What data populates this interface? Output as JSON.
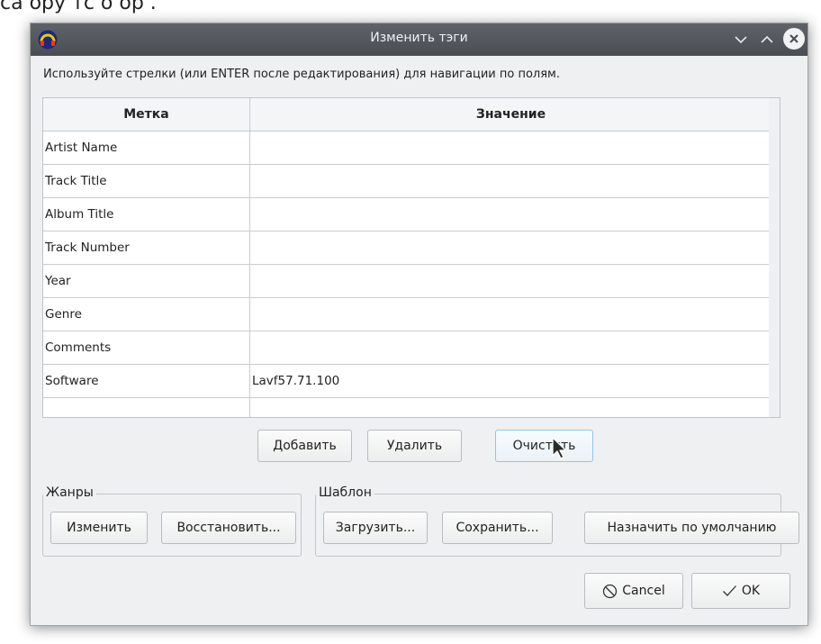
{
  "partial_top_text": "са ору тс о ор .",
  "window": {
    "title": "Изменить тэги"
  },
  "instructions": "Используйте стрелки (или ENTER после редактирования) для навигации по полям.",
  "table": {
    "headers": [
      "Метка",
      "Значение"
    ],
    "rows": [
      {
        "label": "Artist Name",
        "value": ""
      },
      {
        "label": "Track Title",
        "value": ""
      },
      {
        "label": "Album Title",
        "value": ""
      },
      {
        "label": "Track Number",
        "value": ""
      },
      {
        "label": "Year",
        "value": ""
      },
      {
        "label": "Genre",
        "value": ""
      },
      {
        "label": "Comments",
        "value": ""
      },
      {
        "label": "Software",
        "value": "Lavf57.71.100"
      },
      {
        "label": "",
        "value": ""
      }
    ]
  },
  "row_buttons": {
    "add": "Добавить",
    "remove": "Удалить",
    "clear": "Очистить"
  },
  "genres": {
    "legend": "Жанры",
    "edit": "Изменить",
    "restore": "Восстановить..."
  },
  "template": {
    "legend": "Шаблон",
    "load": "Загрузить...",
    "save": "Сохранить...",
    "set_default": "Назначить по умолчанию"
  },
  "footer": {
    "cancel": "Cancel",
    "ok": "OK"
  }
}
